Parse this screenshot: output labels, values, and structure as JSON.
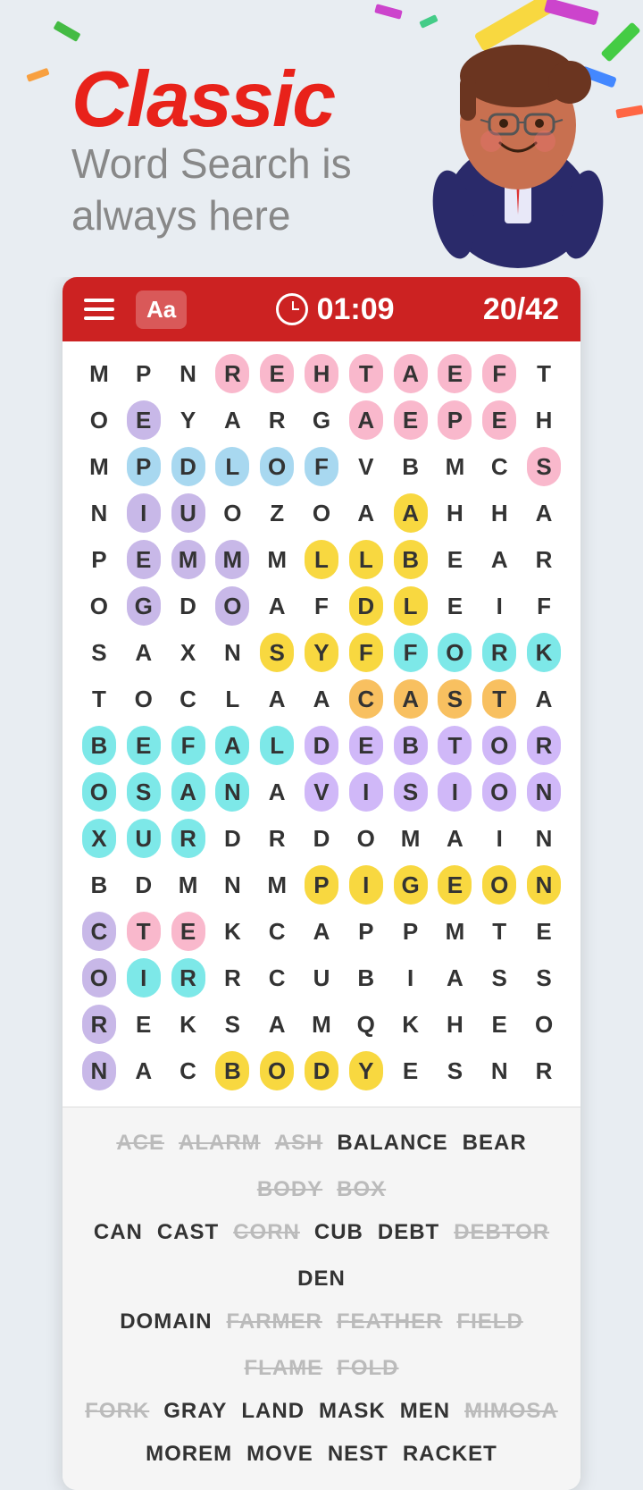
{
  "header": {
    "title": "Classic",
    "subtitle_line1": "Word Search is",
    "subtitle_line2": "always here"
  },
  "toolbar": {
    "font_label": "Aa",
    "timer": "01:09",
    "score": "20/42",
    "menu_aria": "Menu"
  },
  "grid": {
    "rows": [
      [
        "M",
        "P",
        "N",
        "R",
        "E",
        "H",
        "T",
        "A",
        "E",
        "F",
        "T"
      ],
      [
        "O",
        "E",
        "Y",
        "A",
        "R",
        "G",
        "A",
        "E",
        "P",
        "E",
        "H"
      ],
      [
        "M",
        "P",
        "D",
        "L",
        "O",
        "F",
        "V",
        "B",
        "M",
        "C",
        "S"
      ],
      [
        "N",
        "I",
        "U",
        "O",
        "Z",
        "O",
        "A",
        "A",
        "H",
        "H",
        "A"
      ],
      [
        "P",
        "E",
        "M",
        "M",
        "M",
        "L",
        "L",
        "B",
        "E",
        "A",
        "R"
      ],
      [
        "O",
        "G",
        "D",
        "O",
        "A",
        "F",
        "D",
        "L",
        "E",
        "I",
        "F"
      ],
      [
        "S",
        "A",
        "X",
        "N",
        "S",
        "Y",
        "F",
        "F",
        "O",
        "R",
        "K"
      ],
      [
        "T",
        "O",
        "C",
        "L",
        "A",
        "A",
        "C",
        "A",
        "S",
        "T",
        "A"
      ],
      [
        "B",
        "E",
        "F",
        "A",
        "L",
        "D",
        "E",
        "B",
        "T",
        "O",
        "R"
      ],
      [
        "O",
        "S",
        "A",
        "N",
        "A",
        "V",
        "I",
        "S",
        "I",
        "O",
        "N"
      ],
      [
        "X",
        "U",
        "R",
        "D",
        "R",
        "D",
        "O",
        "M",
        "A",
        "I",
        "N"
      ],
      [
        "B",
        "D",
        "M",
        "N",
        "M",
        "P",
        "I",
        "G",
        "E",
        "O",
        "N"
      ],
      [
        "C",
        "T",
        "E",
        "K",
        "C",
        "A",
        "P",
        "P",
        "M",
        "T",
        "E"
      ],
      [
        "O",
        "I",
        "R",
        "R",
        "C",
        "U",
        "B",
        "I",
        "A",
        "S",
        "S"
      ],
      [
        "R",
        "E",
        "K",
        "S",
        "A",
        "M",
        "Q",
        "K",
        "H",
        "E",
        "O"
      ],
      [
        "N",
        "A",
        "C",
        "B",
        "O",
        "D",
        "Y",
        "E",
        "S",
        "N",
        "R"
      ]
    ],
    "highlights": {
      "rehtaef": {
        "cells": [
          [
            0,
            3
          ],
          [
            0,
            4
          ],
          [
            0,
            5
          ],
          [
            0,
            6
          ],
          [
            0,
            7
          ],
          [
            0,
            8
          ],
          [
            0,
            9
          ]
        ],
        "color": "hl-pink"
      },
      "heap": {
        "cells": [
          [
            1,
            8
          ],
          [
            1,
            9
          ],
          [
            1,
            10
          ],
          [
            2,
            10
          ]
        ],
        "color": "hl-pink"
      },
      "pdlof": {
        "cells": [
          [
            2,
            1
          ],
          [
            2,
            2
          ],
          [
            2,
            3
          ],
          [
            2,
            4
          ],
          [
            2,
            5
          ]
        ],
        "color": "hl-blue"
      },
      "fork": {
        "cells": [
          [
            6,
            7
          ],
          [
            6,
            8
          ],
          [
            6,
            9
          ],
          [
            6,
            10
          ]
        ],
        "color": "hl-cyan"
      },
      "debtor": {
        "cells": [
          [
            8,
            5
          ],
          [
            8,
            6
          ],
          [
            8,
            7
          ],
          [
            8,
            8
          ],
          [
            8,
            9
          ],
          [
            8,
            10
          ]
        ],
        "color": "hl-lavender"
      },
      "vision": {
        "cells": [
          [
            9,
            5
          ],
          [
            9,
            6
          ],
          [
            9,
            7
          ],
          [
            9,
            8
          ],
          [
            9,
            9
          ],
          [
            9,
            10
          ]
        ],
        "color": "hl-lavender"
      },
      "pigeon": {
        "cells": [
          [
            11,
            5
          ],
          [
            11,
            6
          ],
          [
            11,
            7
          ],
          [
            11,
            8
          ],
          [
            11,
            9
          ],
          [
            11,
            10
          ]
        ],
        "color": "hl-yellow"
      },
      "body": {
        "cells": [
          [
            15,
            3
          ],
          [
            15,
            4
          ],
          [
            15,
            5
          ],
          [
            15,
            6
          ]
        ],
        "color": "hl-yellow"
      },
      "corn": {
        "cells": [
          [
            12,
            0
          ],
          [
            13,
            0
          ],
          [
            14,
            0
          ],
          [
            15,
            0
          ]
        ],
        "color": "hl-purple"
      },
      "bef": {
        "cells": [
          [
            8,
            0
          ],
          [
            8,
            1
          ],
          [
            8,
            2
          ]
        ],
        "color": "hl-cyan"
      },
      "osal": {
        "cells": [
          [
            9,
            0
          ],
          [
            9,
            1
          ],
          [
            9,
            2
          ],
          [
            9,
            3
          ]
        ],
        "color": "hl-cyan"
      },
      "xur": {
        "cells": [
          [
            10,
            0
          ],
          [
            10,
            1
          ],
          [
            10,
            2
          ]
        ],
        "color": "hl-cyan"
      },
      "r_cyan": {
        "cells": [
          [
            8,
            2
          ],
          [
            9,
            2
          ],
          [
            10,
            2
          ]
        ],
        "color": "hl-cyan"
      },
      "diag1": {
        "cells": [
          [
            1,
            1
          ],
          [
            2,
            1
          ],
          [
            3,
            1
          ],
          [
            4,
            1
          ],
          [
            5,
            1
          ]
        ],
        "color": "hl-purple"
      },
      "diag_yellow": {
        "cells": [
          [
            2,
            2
          ],
          [
            3,
            2
          ],
          [
            4,
            2
          ],
          [
            5,
            3
          ],
          [
            5,
            4
          ]
        ],
        "color": "hl-purple"
      },
      "diag_orange": {
        "cells": [
          [
            3,
            7
          ],
          [
            4,
            7
          ],
          [
            4,
            6
          ],
          [
            5,
            6
          ],
          [
            6,
            6
          ]
        ],
        "color": "hl-orange"
      },
      "ll_yellow": {
        "cells": [
          [
            4,
            5
          ],
          [
            4,
            6
          ],
          [
            5,
            7
          ]
        ],
        "color": "hl-yellow"
      }
    }
  },
  "word_list": {
    "rows": [
      [
        {
          "word": "ACE",
          "found": true
        },
        {
          "word": "ALARM",
          "found": true
        },
        {
          "word": "ASH",
          "found": true
        },
        {
          "word": "BALANCE",
          "found": false
        },
        {
          "word": "BEAR",
          "found": false
        },
        {
          "word": "BODY",
          "found": true
        },
        {
          "word": "BOX",
          "found": true
        }
      ],
      [
        {
          "word": "CAN",
          "found": false
        },
        {
          "word": "CAST",
          "found": false
        },
        {
          "word": "CORN",
          "found": true
        },
        {
          "word": "CUB",
          "found": false
        },
        {
          "word": "DEBT",
          "found": false
        },
        {
          "word": "DEBTOR",
          "found": true
        },
        {
          "word": "DEN",
          "found": false
        }
      ],
      [
        {
          "word": "DOMAIN",
          "found": false
        },
        {
          "word": "FARMER",
          "found": true
        },
        {
          "word": "FEATHER",
          "found": true
        },
        {
          "word": "FIELD",
          "found": true
        },
        {
          "word": "FLAME",
          "found": true
        },
        {
          "word": "FOLD",
          "found": true
        }
      ],
      [
        {
          "word": "FORK",
          "found": true
        },
        {
          "word": "GRAY",
          "found": false
        },
        {
          "word": "LAND",
          "found": false
        },
        {
          "word": "MASK",
          "found": false
        },
        {
          "word": "MEN",
          "found": false
        },
        {
          "word": "MIMOSA",
          "found": true
        }
      ],
      [
        {
          "word": "MOREM",
          "found": false
        },
        {
          "word": "MOVE",
          "found": false
        },
        {
          "word": "NEST",
          "found": false
        },
        {
          "word": "RACKET",
          "found": false
        }
      ]
    ]
  },
  "colors": {
    "toolbar_bg": "#cc2222",
    "header_bg": "#e8edf2",
    "accent_red": "#e8221a"
  }
}
